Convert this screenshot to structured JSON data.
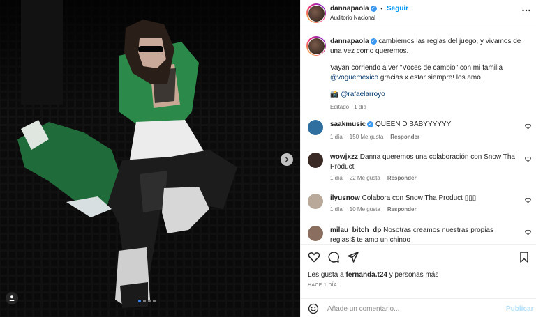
{
  "colors": {
    "accent": "#0095f6",
    "verified": "#3897f0",
    "muted": "#737373",
    "link": "#00376b"
  },
  "post": {
    "username": "dannapaola",
    "follow_label": "Seguir",
    "separator": "•",
    "location": "Auditorio Nacional",
    "more_icon": "more-horizontal-icon"
  },
  "caption": {
    "username": "dannapaola",
    "line1": "cambiemos las reglas del juego, y vivamos de una vez como queremos.",
    "line2_pre": "Vayan corriendo a ver \"Voces de cambio\" con mi familia",
    "mention1": "@voguemexico",
    "line2_post": "gracias x estar siempre! los amo.",
    "camera_emoji": "📸",
    "mention2": "@rafaelarroyo",
    "meta": "Editado · 1 día"
  },
  "comments": [
    {
      "username": "saakmusic",
      "verified": true,
      "text": "QUEEN D BABYYYYYY",
      "time": "1 día",
      "likes": "150 Me gusta",
      "reply": "Responder"
    },
    {
      "username": "wowjxzz",
      "verified": false,
      "text": "Danna queremos una colaboración con Snow Tha Product",
      "time": "1 día",
      "likes": "22 Me gusta",
      "reply": "Responder"
    },
    {
      "username": "ilyusnow",
      "verified": false,
      "text": "Colabora con Snow Tha Product ▯▯▯",
      "time": "1 día",
      "likes": "10 Me gusta",
      "reply": "Responder"
    },
    {
      "username": "milau_bitch_dp",
      "verified": false,
      "text": "Nosotras creamos nuestras propias reglas!$ te amo un chinoo"
    }
  ],
  "actions": {
    "likes_prefix": "Les gusta a",
    "likes_user": "fernanda.t24",
    "likes_suffix": "y personas más",
    "date": "HACE 1 DÍA"
  },
  "composer": {
    "placeholder": "Añade un comentario...",
    "publish_label": "Publicar"
  },
  "carousel": {
    "total": 4,
    "active": 0
  }
}
